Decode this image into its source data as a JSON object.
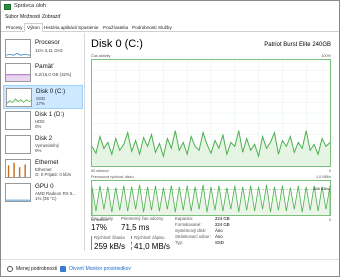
{
  "window": {
    "title": "Správca úloh"
  },
  "menu": [
    "Súbor",
    "Možnosti",
    "Zobraziť"
  ],
  "tabs": [
    "Procesy",
    "Výkon",
    "História aplikácií",
    "Spustenie",
    "Používatelia",
    "Podrobnosti",
    "Služby"
  ],
  "sidebar": [
    {
      "name": "Procesor",
      "sub": "11% 3,11 GHz",
      "sub2": ""
    },
    {
      "name": "Pamäť",
      "sub": "5,2/16,0 GB (32%)",
      "sub2": ""
    },
    {
      "name": "Disk 0 (C:)",
      "sub": "SSD",
      "sub2": "17%"
    },
    {
      "name": "Disk 1 (D:)",
      "sub": "HDD",
      "sub2": "0%"
    },
    {
      "name": "Disk 2",
      "sub": "Vymeniteľný",
      "sub2": "0%"
    },
    {
      "name": "Ethernet",
      "sub": "Ethernet",
      "sub2": "O: 0 Prijaté: 0 kb/s"
    },
    {
      "name": "GPU 0",
      "sub": "AMD Radeon RX 5...",
      "sub2": "1% (35 °C)"
    }
  ],
  "main": {
    "heading": "Disk 0 (C:)",
    "model": "Patriot Burst Elite 240GB",
    "g1_label": "Čas aktivity",
    "g1_max": "100%",
    "g1_time": "60 sekúnd",
    "g1_min": "0",
    "g2_label": "Prenosová rýchlosť disku",
    "g2_max": "1,0 MB/s",
    "g2_mid": "800 KB/s",
    "g2_time": "60 sekúnd",
    "g2_min": "0"
  },
  "stats": {
    "activity_label": "Čas aktivity",
    "activity_value": "17%",
    "resp_label": "Priemerný čas odozvy",
    "resp_value": "71,5 ms",
    "read_label": "Rýchlosť čítania",
    "read_value": "259 kB/s",
    "write_label": "Rýchlosť zápisu",
    "write_value": "41,0 MB/s"
  },
  "props": [
    {
      "k": "Kapacita:",
      "v": "224 GB"
    },
    {
      "k": "Formátované:",
      "v": "224 GB"
    },
    {
      "k": "Systémový disk:",
      "v": "Áno"
    },
    {
      "k": "Stránkovací súbor:",
      "v": "Áno"
    },
    {
      "k": "Typ:",
      "v": "SSD"
    }
  ],
  "footer": {
    "less": "Menej podrobností",
    "monitor": "Otvoriť Monitor prostriedkov"
  },
  "colors": {
    "accent": "#4caf50",
    "selected": "#cde8ff",
    "link": "#1a6bc4"
  }
}
